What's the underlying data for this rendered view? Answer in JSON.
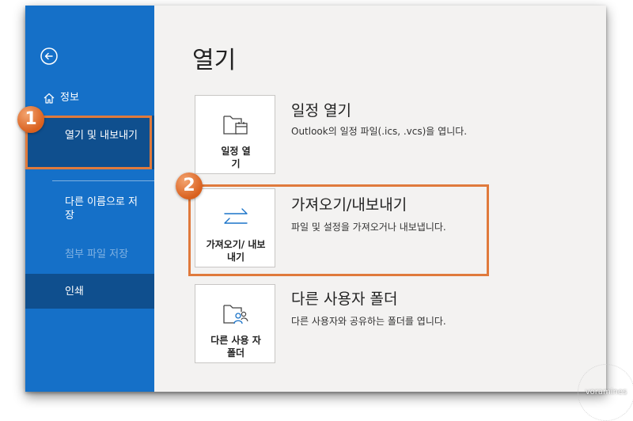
{
  "sidebar": {
    "info_label": "정보",
    "open_export_label": "열기 및 내보내기",
    "save_as_label": "다른 이름으로 저장",
    "save_attachments_label": "첨부 파일 저장",
    "print_label": "인쇄"
  },
  "main": {
    "title": "열기",
    "options": [
      {
        "tile_label": "일정 열기",
        "title": "일정 열기",
        "description": "Outlook의 일정 파일(.ics, .vcs)을 엽니다."
      },
      {
        "tile_label": "가져오기/ 내보내기",
        "title": "가져오기/내보내기",
        "description": "파일 및 설정을 가져오거나 내보냅니다."
      },
      {
        "tile_label": "다른 사용 자 폴더",
        "title": "다른 사용자 폴더",
        "description": "다른 사용자와 공유하는 폴더를 엽니다."
      }
    ]
  },
  "annotations": {
    "badge_1": "1",
    "badge_2": "2"
  },
  "watermark": "voramines",
  "colors": {
    "sidebar_bg": "#1570c8",
    "sidebar_selected": "#0f4f8e",
    "highlight": "#e07a3c",
    "icon_blue": "#1a73c8"
  }
}
